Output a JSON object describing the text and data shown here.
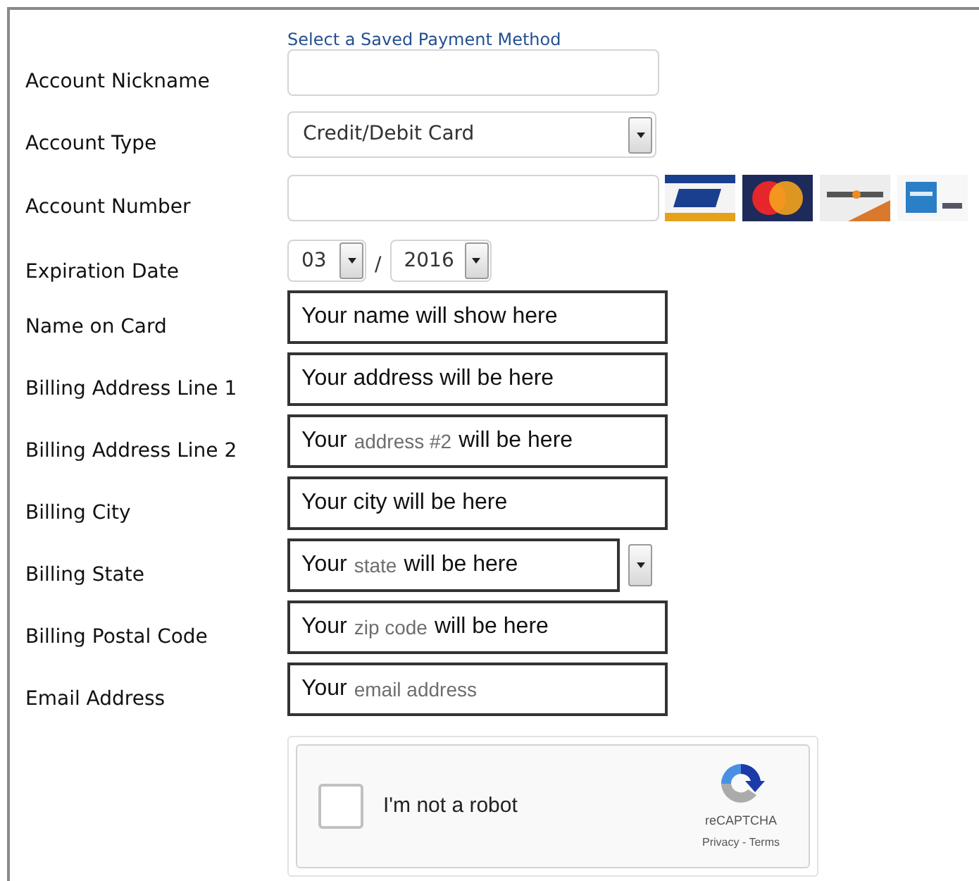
{
  "header_link": "Select a Saved Payment Method",
  "rows": [
    {
      "kind": "input",
      "label": "Account Nickname"
    },
    {
      "kind": "select",
      "label": "Account Type",
      "value": "Credit/Debit Card"
    },
    {
      "kind": "card_input",
      "label": "Account Number"
    },
    {
      "kind": "expiry",
      "label": "Expiration Date",
      "month": "03",
      "separator": "/",
      "year": "2016"
    },
    {
      "kind": "filled",
      "label": "Name on Card",
      "parts": [
        {
          "text": "Your name will show here",
          "muted": false
        }
      ]
    },
    {
      "kind": "filled",
      "label": "Billing Address Line 1",
      "parts": [
        {
          "text": "Your address will be here",
          "muted": false
        }
      ]
    },
    {
      "kind": "filled",
      "label": "Billing Address Line 2",
      "parts": [
        {
          "text": "Your",
          "muted": false
        },
        {
          "text": "address #2",
          "muted": true
        },
        {
          "text": "will be here",
          "muted": false
        }
      ]
    },
    {
      "kind": "filled",
      "label": "Billing City",
      "parts": [
        {
          "text": "Your city will be here",
          "muted": false
        }
      ]
    },
    {
      "kind": "filled_select",
      "label": "Billing State",
      "parts": [
        {
          "text": "Your",
          "muted": false
        },
        {
          "text": "state",
          "muted": true
        },
        {
          "text": "will be here",
          "muted": false
        }
      ]
    },
    {
      "kind": "filled",
      "label": "Billing Postal Code",
      "parts": [
        {
          "text": "Your",
          "muted": false
        },
        {
          "text": "zip code",
          "muted": true
        },
        {
          "text": "will be here",
          "muted": false
        }
      ]
    },
    {
      "kind": "filled",
      "label": "Email Address",
      "parts": [
        {
          "text": "Your",
          "muted": false
        },
        {
          "text": "email address",
          "muted": true
        }
      ]
    }
  ],
  "captcha": {
    "checked": false,
    "label": "I'm not a robot",
    "brand": "reCAPTCHA",
    "links": "Privacy - Terms"
  }
}
